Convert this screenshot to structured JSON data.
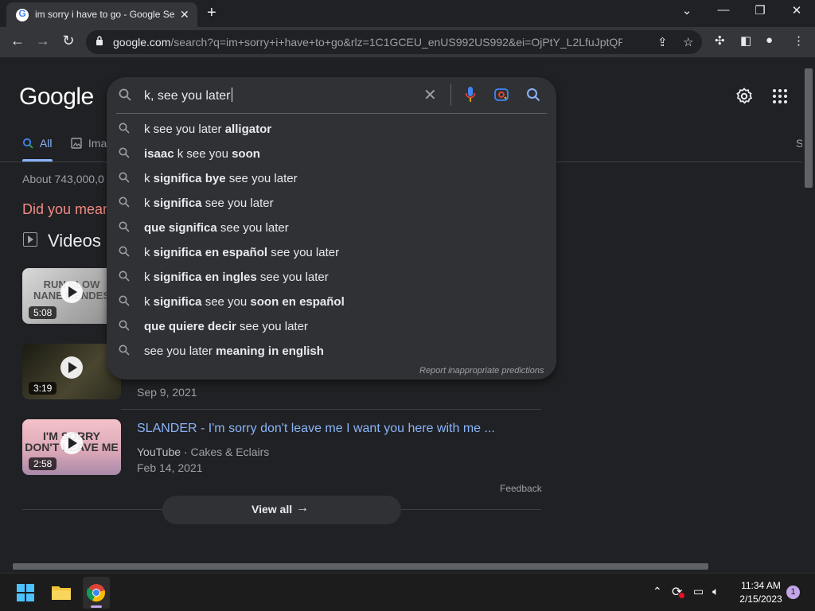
{
  "browser": {
    "tab_title": "im sorry i have to go - Google Se",
    "favicon_letter": "G",
    "close_tab": "✕",
    "new_tab": "+",
    "window_controls": {
      "dropdown": "⌄",
      "minimize": "—",
      "restore": "❐",
      "close": "✕"
    },
    "url_host": "google.com",
    "url_path": "/search?q=im+sorry+i+have+to+go&rlz=1C1GCEU_enUS992US992&ei=OjPtY_L2LfuJptQPrJOe..."
  },
  "google": {
    "logo": "Google",
    "query": "k, see you later",
    "suggestions": [
      [
        {
          "t": "k see you later ",
          "b": false
        },
        {
          "t": "alligator",
          "b": true
        }
      ],
      [
        {
          "t": "isaac",
          "b": true
        },
        {
          "t": " k see you ",
          "b": false
        },
        {
          "t": "soon",
          "b": true
        }
      ],
      [
        {
          "t": "k ",
          "b": false
        },
        {
          "t": "significa bye",
          "b": true
        },
        {
          "t": " see you later",
          "b": false
        }
      ],
      [
        {
          "t": "k ",
          "b": false
        },
        {
          "t": "significa",
          "b": true
        },
        {
          "t": " see you later",
          "b": false
        }
      ],
      [
        {
          "t": "que significa",
          "b": true
        },
        {
          "t": " see you later",
          "b": false
        }
      ],
      [
        {
          "t": "k ",
          "b": false
        },
        {
          "t": "significa en español",
          "b": true
        },
        {
          "t": " see you later",
          "b": false
        }
      ],
      [
        {
          "t": "k ",
          "b": false
        },
        {
          "t": "significa en ingles",
          "b": true
        },
        {
          "t": " see you later",
          "b": false
        }
      ],
      [
        {
          "t": "k ",
          "b": false
        },
        {
          "t": "significa",
          "b": true
        },
        {
          "t": " see you ",
          "b": false
        },
        {
          "t": "soon en español",
          "b": true
        }
      ],
      [
        {
          "t": "que quiere decir",
          "b": true
        },
        {
          "t": " see you later",
          "b": false
        }
      ],
      [
        {
          "t": "see you later ",
          "b": false
        },
        {
          "t": "meaning in english",
          "b": true
        }
      ]
    ],
    "report_text": "Report inappropriate predictions",
    "nav_all": "All",
    "nav_images": "Ima",
    "nav_right_cut": "S",
    "about": "About 743,000,0",
    "did_you_mean": "Did you mean",
    "videos_heading": "Videos"
  },
  "videos": [
    {
      "duration": "5:08",
      "thumb_text": "RUN SLOW\nNANE MENDES",
      "title": "",
      "meta": "",
      "date": ""
    },
    {
      "duration": "3:19",
      "thumb_text": "",
      "title": "",
      "meta": "",
      "date": "Sep 9, 2021"
    },
    {
      "duration": "2:58",
      "thumb_text": "I'M SORRY\nDON'T LEAVE ME",
      "title": "SLANDER - I'm sorry don't leave me I want you here with me ...",
      "source": "YouTube",
      "channel": "Cakes & Eclairs",
      "date": "Feb 14, 2021"
    }
  ],
  "feedback": "Feedback",
  "view_all": "View all",
  "taskbar": {
    "time": "11:34 AM",
    "date": "2/15/2023",
    "notifications": "1"
  }
}
